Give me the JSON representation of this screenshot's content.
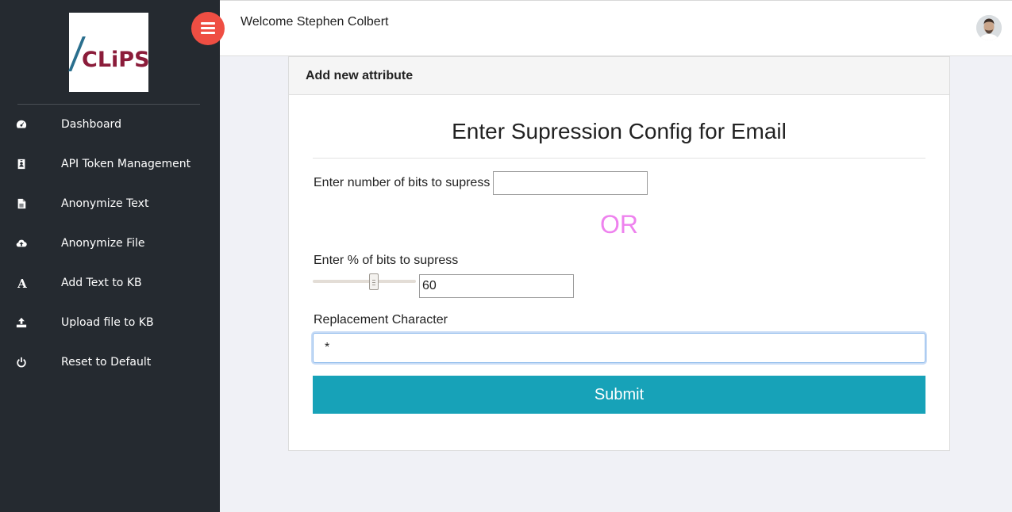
{
  "brand": {
    "logo_text": "CLiPS"
  },
  "sidebar": {
    "items": [
      {
        "label": "Dashboard",
        "icon": "dashboard-icon"
      },
      {
        "label": "API Token Management",
        "icon": "badge-icon"
      },
      {
        "label": "Anonymize Text",
        "icon": "file-text-icon"
      },
      {
        "label": "Anonymize File",
        "icon": "cloud-upload-icon"
      },
      {
        "label": "Add Text to KB",
        "icon": "font-icon"
      },
      {
        "label": "Upload file to KB",
        "icon": "upload-icon"
      },
      {
        "label": "Reset to Default",
        "icon": "power-icon"
      }
    ]
  },
  "header": {
    "welcome": "Welcome Stephen Colbert"
  },
  "card": {
    "title": "Add new attribute",
    "heading": "Enter Supression Config for Email",
    "bits_label": "Enter number of bits to supress",
    "bits_value": "",
    "or_text": "OR",
    "percent_label": "Enter % of bits to supress",
    "percent_value": "60",
    "slider_level": 60,
    "replacement_label": "Replacement Character",
    "replacement_value": "*",
    "submit_label": "Submit"
  },
  "colors": {
    "sidebar_bg": "#252a30",
    "toggle": "#ef4e43",
    "or_text": "#ee82ee",
    "submit_bg": "#17a2b8",
    "logo_text": "#8b1c3a"
  }
}
